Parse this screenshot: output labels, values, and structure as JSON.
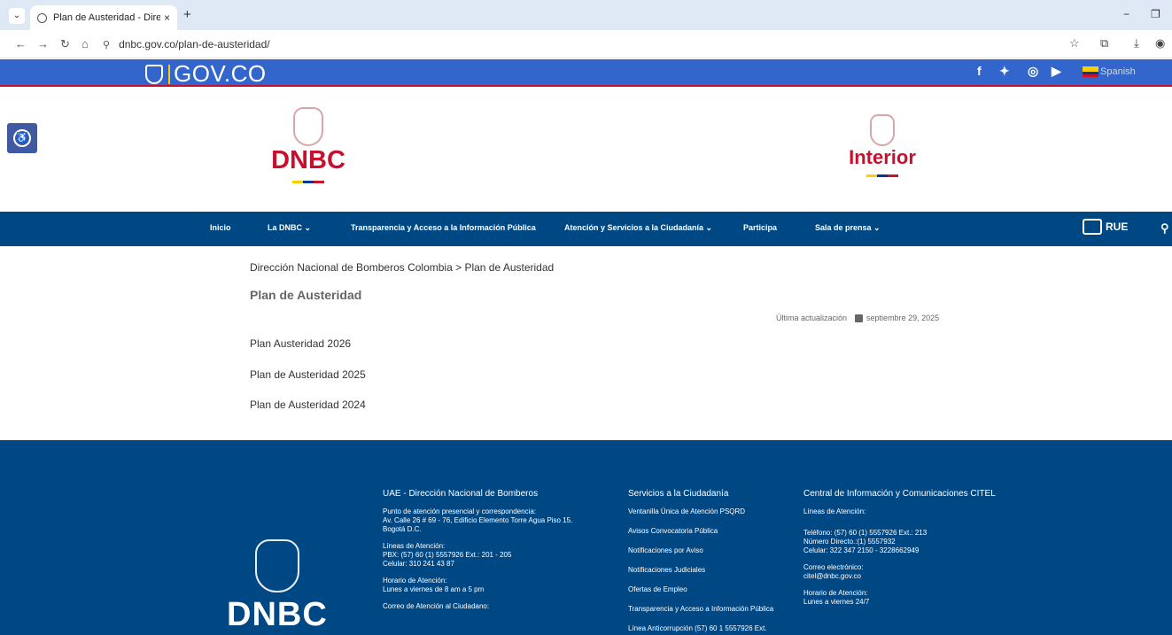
{
  "browser": {
    "tab_title": "Plan de Austeridad - Dirección I",
    "tab_close": "×",
    "new_tab": "+",
    "url": "dnbc.gov.co/plan-de-austeridad/",
    "minimize": "−",
    "restore": "❐"
  },
  "govbar": {
    "logo_text": "GOV.CO",
    "language": "Spanish",
    "flag_colors": [
      "#ffcd00",
      "#003893",
      "#ce1126"
    ]
  },
  "header": {
    "left_logo_text": "DNBC",
    "right_logo_text": "Interior",
    "brand_red": "#c8102e"
  },
  "nav": {
    "items": [
      {
        "label": "Inicio"
      },
      {
        "label": "La DNBC ⌄"
      },
      {
        "label": "Transparencia y Acceso a la Información Pública"
      },
      {
        "label": "Atención y Servicios a la Ciudadanía ⌄"
      },
      {
        "label": "Participa"
      },
      {
        "label": "Sala de prensa ⌄"
      }
    ],
    "rue_label": "RUE",
    "search_icon": "search-icon",
    "color": "#004884"
  },
  "content": {
    "breadcrumb": "Dirección Nacional de Bomberos Colombia > Plan de Austeridad",
    "title": "Plan de Austeridad",
    "updated_label": "Última actualización",
    "updated_date": "septiembre 29, 2025",
    "documents": [
      "Plan Austeridad 2026",
      "Plan de Austeridad 2025",
      "Plan de Austeridad 2024"
    ]
  },
  "footer": {
    "logo_text": "DNBC",
    "col1": {
      "title": "UAE - Dirección Nacional de Bomberos",
      "address_label": "Punto de atención presencial y correspondencia:",
      "address": "Av. Calle 26 # 69 - 76, Edificio Elemento Torre Agua Piso 15.",
      "city": "Bogotá D.C.",
      "lines_label": "Líneas de Atención:",
      "pbx": "PBX: (57) 60 (1) 5557926 Ext.: 201 - 205",
      "cell": "Celular: 310 241 43 87",
      "hours_label": "Horario de Atención:",
      "hours": "Lunes a viernes de 8 am a 5 pm",
      "email_label": "Correo de Atención al Ciudadano:"
    },
    "col2": {
      "title": "Servicios a la Ciudadanía",
      "links": [
        "Ventanilla Única de Atención PSQRD",
        "Avisos Convocatoria Pública",
        "Notificaciones por Aviso",
        "Notificaciones Judiciales",
        "Ofertas de Empleo",
        " Transparencia y Acceso a Información Pública",
        " Línea Anticorrupción (57) 60 1 5557926 Ext."
      ]
    },
    "col3": {
      "title": "Central de Información y Comunicaciones CITEL",
      "lines_label": "Líneas de Atención:",
      "phone": "Teléfono: (57) 60 (1) 5557926 Ext.: 213",
      "direct": "Número Directo.:(1) 5557932",
      "cell": "Celular: 322 347 2150 - 3228662949",
      "email_label": "Correo electrónico:",
      "email": "citel@dnbc.gov.co",
      "hours_label": "Horario de Atención:",
      "hours": "Lunes a viernes 24/7"
    }
  }
}
